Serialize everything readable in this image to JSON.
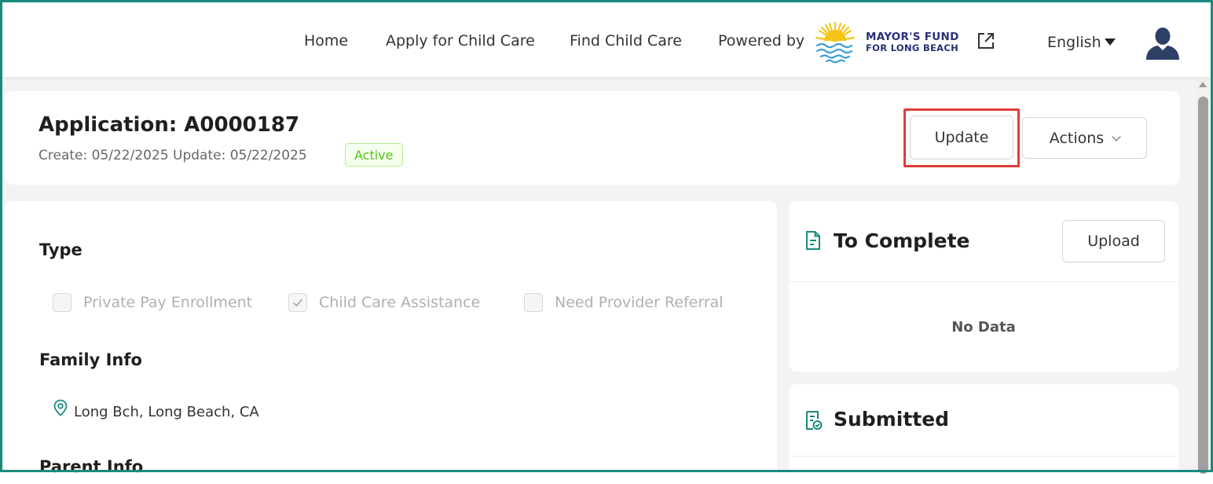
{
  "nav": {
    "home": "Home",
    "apply": "Apply for Child Care",
    "find": "Find Child Care",
    "powered_by": "Powered by",
    "logo_line1": "MAYOR'S FUND",
    "logo_line2": "FOR LONG BEACH",
    "language": "English"
  },
  "application": {
    "title": "Application: A0000187",
    "dates": "Create: 05/22/2025   Update: 05/22/2025",
    "status": "Active",
    "update_label": "Update",
    "actions_label": "Actions"
  },
  "type_section": {
    "heading": "Type",
    "options": [
      {
        "label": "Private Pay Enrollment",
        "checked": false
      },
      {
        "label": "Child Care Assistance",
        "checked": true
      },
      {
        "label": "Need Provider Referral",
        "checked": false
      }
    ]
  },
  "family_info": {
    "heading": "Family Info",
    "location": "Long Bch, Long Beach, CA"
  },
  "parent_info": {
    "heading": "Parent Info"
  },
  "to_complete": {
    "title": "To Complete",
    "upload_label": "Upload",
    "empty_text": "No Data"
  },
  "submitted": {
    "title": "Submitted"
  },
  "colors": {
    "frame_border": "#1a8a7d",
    "highlight": "#e23b3b",
    "active_badge": "#52c41a",
    "icon_teal": "#1a8a7d",
    "logo_navy": "#2b2f7a",
    "logo_sun": "#f5c518"
  }
}
